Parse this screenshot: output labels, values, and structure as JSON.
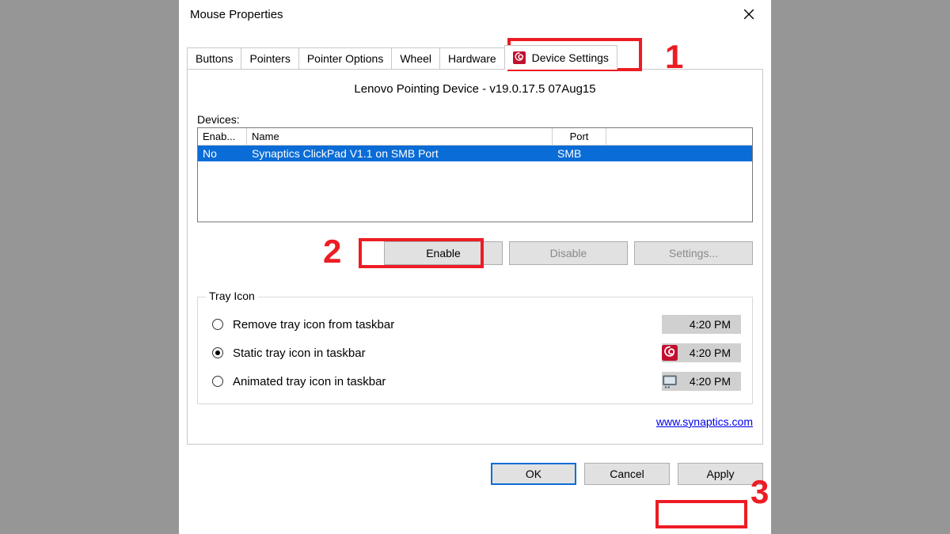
{
  "window": {
    "title": "Mouse Properties"
  },
  "tabs": [
    {
      "label": "Buttons"
    },
    {
      "label": "Pointers"
    },
    {
      "label": "Pointer Options"
    },
    {
      "label": "Wheel"
    },
    {
      "label": "Hardware"
    },
    {
      "label": "Device Settings"
    }
  ],
  "driver_title": "Lenovo Pointing Device - v19.0.17.5 07Aug15",
  "devices": {
    "label": "Devices:",
    "columns": {
      "enab": "Enab...",
      "name": "Name",
      "port": "Port"
    },
    "rows": [
      {
        "enab": "No",
        "name": "Synaptics ClickPad V1.1 on SMB Port",
        "port": "SMB"
      }
    ]
  },
  "buttons": {
    "enable": "Enable",
    "disable": "Disable",
    "settings": "Settings..."
  },
  "tray": {
    "legend": "Tray Icon",
    "options": [
      {
        "label": "Remove tray icon from taskbar",
        "time": "4:20 PM",
        "icon": "none"
      },
      {
        "label": "Static tray icon in taskbar",
        "time": "4:20 PM",
        "icon": "swirl"
      },
      {
        "label": "Animated tray icon in taskbar",
        "time": "4:20 PM",
        "icon": "touchpad"
      }
    ],
    "selected_index": 1
  },
  "link": {
    "text": "www.synaptics.com"
  },
  "dialog_buttons": {
    "ok": "OK",
    "cancel": "Cancel",
    "apply": "Apply"
  },
  "annotations": {
    "n1": "1",
    "n2": "2",
    "n3": "3"
  },
  "colors": {
    "accent": "#0a6cd6",
    "annot": "#ed1c24",
    "swirl_bg": "#c21030"
  }
}
